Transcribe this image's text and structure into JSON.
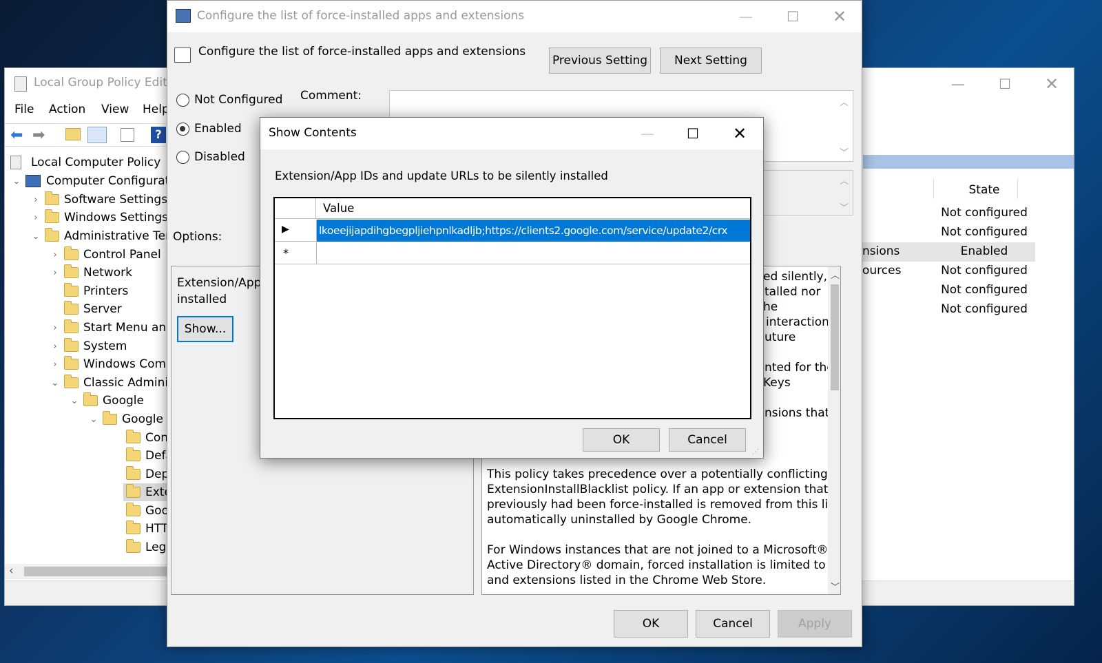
{
  "gpedit": {
    "title": "Local Group Policy Editor",
    "menu": [
      "File",
      "Action",
      "View",
      "Help"
    ],
    "tree": [
      {
        "label": "Local Computer Policy",
        "indent": 0,
        "chevron": ""
      },
      {
        "label": "Computer Configuration",
        "indent": 0,
        "chevron": "v"
      },
      {
        "label": "Software Settings",
        "indent": 1,
        "chevron": ">"
      },
      {
        "label": "Windows Settings",
        "indent": 1,
        "chevron": ">"
      },
      {
        "label": "Administrative Templates",
        "indent": 1,
        "chevron": "v"
      },
      {
        "label": "Control Panel",
        "indent": 2,
        "chevron": ">"
      },
      {
        "label": "Network",
        "indent": 2,
        "chevron": ">"
      },
      {
        "label": "Printers",
        "indent": 2,
        "chevron": ""
      },
      {
        "label": "Server",
        "indent": 2,
        "chevron": ""
      },
      {
        "label": "Start Menu and Taskbar",
        "indent": 2,
        "chevron": ">"
      },
      {
        "label": "System",
        "indent": 2,
        "chevron": ">"
      },
      {
        "label": "Windows Components",
        "indent": 2,
        "chevron": ">"
      },
      {
        "label": "Classic Administrative Templates",
        "indent": 2,
        "chevron": "v"
      },
      {
        "label": "Google",
        "indent": 3,
        "chevron": "v"
      },
      {
        "label": "Google Chrome",
        "indent": 4,
        "chevron": "v"
      },
      {
        "label": "Content settings",
        "indent": 5,
        "chevron": ""
      },
      {
        "label": "Default search provider",
        "indent": 5,
        "chevron": ""
      },
      {
        "label": "Deprecated policies",
        "indent": 5,
        "chevron": ""
      },
      {
        "label": "Extensions",
        "indent": 5,
        "chevron": "",
        "selected": true
      },
      {
        "label": "Google Cast",
        "indent": 5,
        "chevron": ""
      },
      {
        "label": "HTTP authentication",
        "indent": 5,
        "chevron": ""
      },
      {
        "label": "Legacy Browser Support",
        "indent": 5,
        "chevron": ""
      }
    ],
    "state_header": "State",
    "rows": [
      {
        "setting": "",
        "state": "Not configured"
      },
      {
        "setting": "",
        "state": "Not configured"
      },
      {
        "setting": "nsions",
        "state": "Enabled"
      },
      {
        "setting": "ources",
        "state": "Not configured"
      },
      {
        "setting": "",
        "state": "Not configured"
      },
      {
        "setting": "",
        "state": "Not configured"
      }
    ]
  },
  "policy": {
    "window_title": "Configure the list of force-installed apps and extensions",
    "heading": "Configure the list of force-installed apps and extensions",
    "prev_button": "Previous Setting",
    "next_button": "Next Setting",
    "radio_not_configured": "Not Configured",
    "radio_enabled": "Enabled",
    "radio_disabled": "Disabled",
    "comment_label": "Comment:",
    "options_label": "Options:",
    "option_text_1": "Extension/App IDs and update URLs to be silently",
    "option_text_2": "installed",
    "show_button": "Show...",
    "help_visible_fragments": [
      "ed silently,",
      "talled nor",
      "he",
      "interaction,",
      "uture",
      "nted for the",
      "Keys",
      "nsions that"
    ],
    "help_paragraph_1": [
      "This policy takes precedence over a potentially conflicting",
      "ExtensionInstallBlacklist policy. If an app or extension that",
      "previously had been force-installed is removed from this list, it is",
      "automatically uninstalled by Google Chrome."
    ],
    "help_paragraph_2": [
      "For Windows instances that are not joined to a Microsoft®",
      "Active Directory® domain, forced installation is limited to apps",
      "and extensions listed in the Chrome Web Store."
    ],
    "ok": "OK",
    "cancel": "Cancel",
    "apply": "Apply"
  },
  "show_contents": {
    "title": "Show Contents",
    "label": "Extension/App IDs and update URLs to be silently installed",
    "column_header": "Value",
    "row_value": "lkoeejijapdihgbegpljiehpnlkadljb;https://clients2.google.com/service/update2/crx",
    "ok": "OK",
    "cancel": "Cancel"
  },
  "colors": {
    "selection_blue": "#0078d7",
    "focus_blue": "#0078d7",
    "header_band": "#a8c3e6"
  }
}
